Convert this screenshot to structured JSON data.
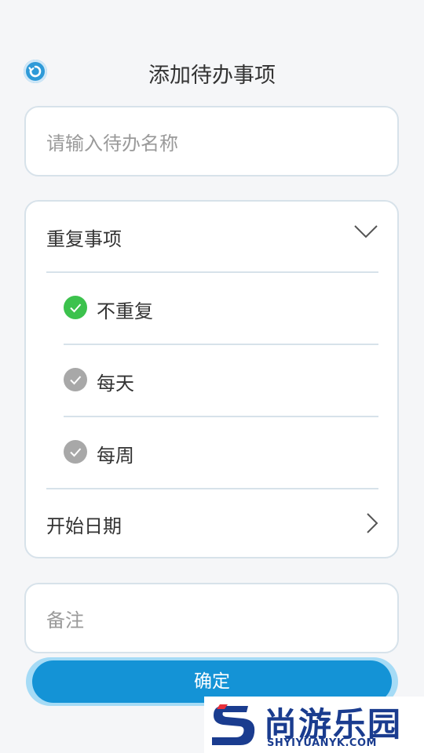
{
  "header": {
    "title": "添加待办事项"
  },
  "name_field": {
    "placeholder": "请输入待办名称",
    "value": ""
  },
  "repeat": {
    "label": "重复事项",
    "options": [
      {
        "label": "不重复",
        "selected": true
      },
      {
        "label": "每天",
        "selected": false
      },
      {
        "label": "每周",
        "selected": false
      }
    ]
  },
  "start_date": {
    "label": "开始日期"
  },
  "note_field": {
    "placeholder": "备注",
    "value": ""
  },
  "confirm": {
    "label": "确定"
  },
  "watermark": {
    "name": "尚游乐园",
    "url": "SHYIYUANYK.COM"
  },
  "colors": {
    "accent": "#1493d6",
    "selected_check": "#3cc24d",
    "unselected_check": "#a8a8a8",
    "border": "#d7e2ea",
    "background": "#f5f6f8"
  }
}
